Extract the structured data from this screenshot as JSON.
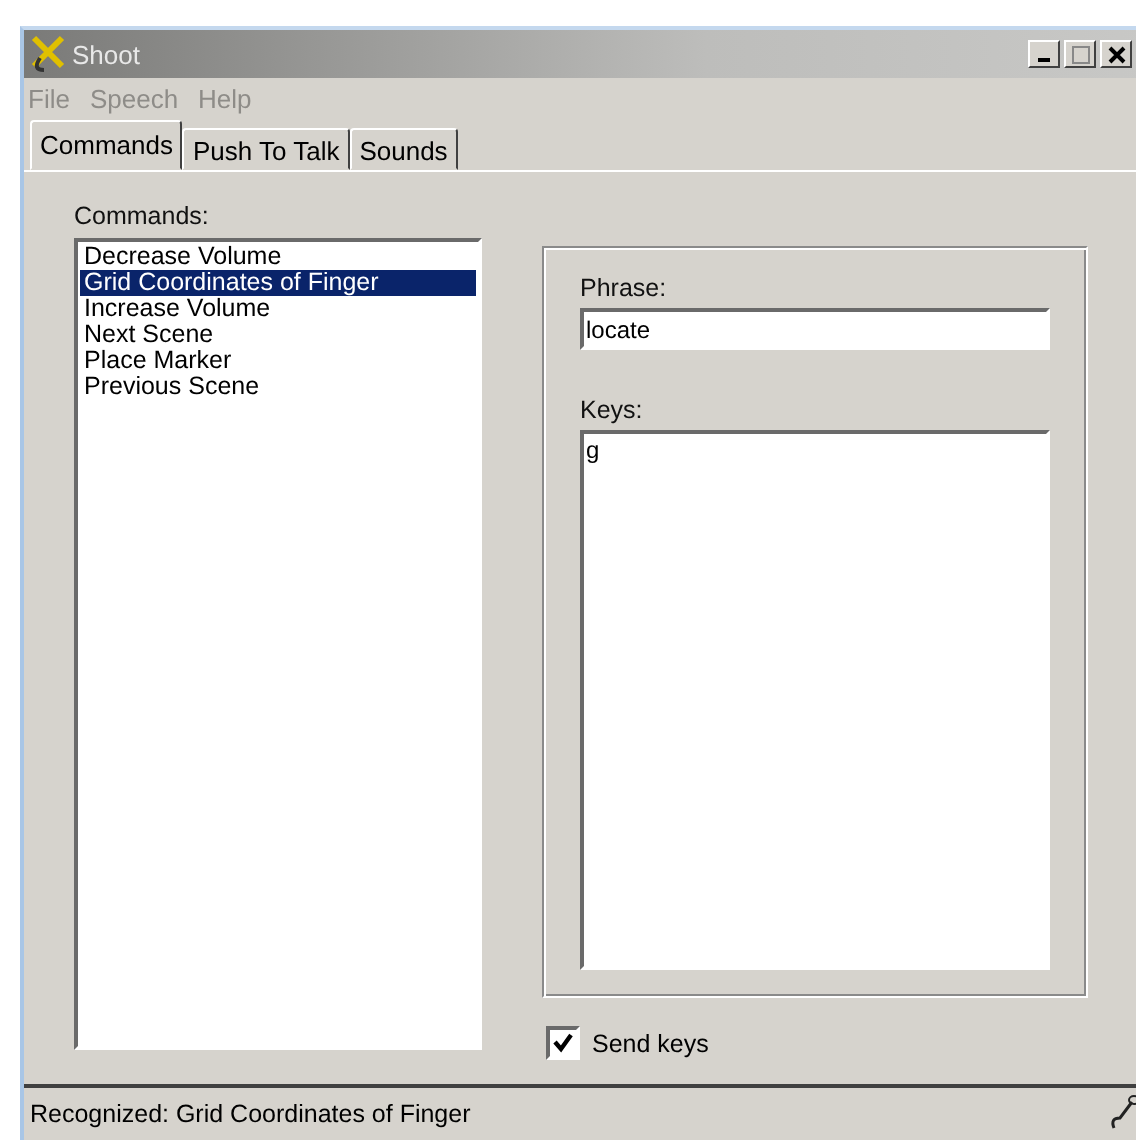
{
  "window": {
    "title": "Shoot"
  },
  "menu": [
    "File",
    "Speech",
    "Help"
  ],
  "tabs": [
    {
      "label": "Commands",
      "selected": true
    },
    {
      "label": "Push To Talk",
      "selected": false
    },
    {
      "label": "Sounds",
      "selected": false
    }
  ],
  "commands": {
    "label": "Commands:",
    "items": [
      {
        "label": "Decrease Volume",
        "selected": false
      },
      {
        "label": "Grid Coordinates of Finger",
        "selected": true
      },
      {
        "label": "Increase Volume",
        "selected": false
      },
      {
        "label": "Next Scene",
        "selected": false
      },
      {
        "label": "Place Marker",
        "selected": false
      },
      {
        "label": "Previous Scene",
        "selected": false
      }
    ]
  },
  "phrase": {
    "label": "Phrase:",
    "value": "locate"
  },
  "keys": {
    "label": "Keys:",
    "value": "g"
  },
  "send_keys": {
    "label": "Send keys",
    "checked": true
  },
  "status_bar": {
    "text": "Recognized: Grid Coordinates of Finger"
  }
}
